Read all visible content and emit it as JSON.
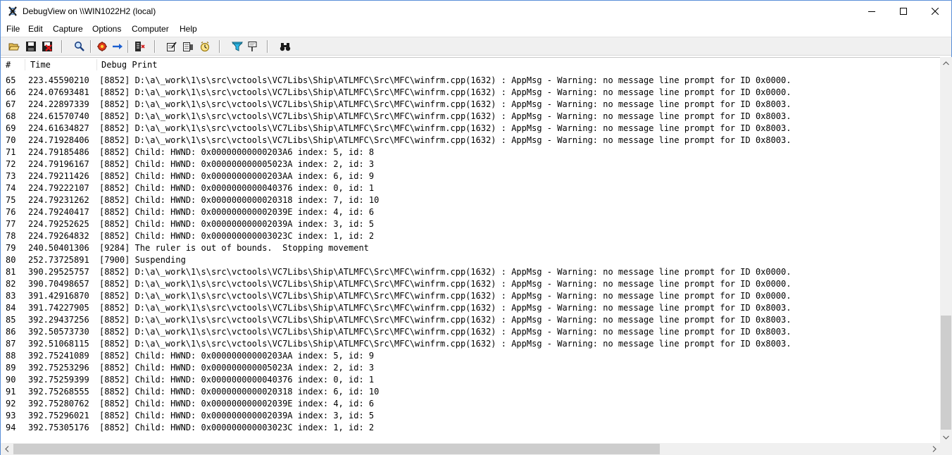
{
  "window": {
    "title": "DebugView on \\\\WIN1022H2 (local)"
  },
  "menu": [
    "File",
    "Edit",
    "Capture",
    "Options",
    "Computer",
    "Help"
  ],
  "toolbar": {
    "buttons": [
      "open-icon",
      "save-icon",
      "clear-display-icon",
      "find-icon",
      "capture-icon",
      "autoscroll-icon",
      "history-icon",
      "capture-win32-icon",
      "capture-kernel-icon",
      "clock-time-icon",
      "filter-icon",
      "highlight-icon",
      "binoculars-icon"
    ]
  },
  "columns": [
    "#",
    "Time",
    "Debug Print"
  ],
  "rows": [
    {
      "num": "65",
      "time": "223.45590210",
      "msg": "[8852] D:\\a\\_work\\1\\s\\src\\vctools\\VC7Libs\\Ship\\ATLMFC\\Src\\MFC\\winfrm.cpp(1632) : AppMsg - Warning: no message line prompt for ID 0x0000."
    },
    {
      "num": "66",
      "time": "224.07693481",
      "msg": "[8852] D:\\a\\_work\\1\\s\\src\\vctools\\VC7Libs\\Ship\\ATLMFC\\Src\\MFC\\winfrm.cpp(1632) : AppMsg - Warning: no message line prompt for ID 0x0000."
    },
    {
      "num": "67",
      "time": "224.22897339",
      "msg": "[8852] D:\\a\\_work\\1\\s\\src\\vctools\\VC7Libs\\Ship\\ATLMFC\\Src\\MFC\\winfrm.cpp(1632) : AppMsg - Warning: no message line prompt for ID 0x8003."
    },
    {
      "num": "68",
      "time": "224.61570740",
      "msg": "[8852] D:\\a\\_work\\1\\s\\src\\vctools\\VC7Libs\\Ship\\ATLMFC\\Src\\MFC\\winfrm.cpp(1632) : AppMsg - Warning: no message line prompt for ID 0x8003."
    },
    {
      "num": "69",
      "time": "224.61634827",
      "msg": "[8852] D:\\a\\_work\\1\\s\\src\\vctools\\VC7Libs\\Ship\\ATLMFC\\Src\\MFC\\winfrm.cpp(1632) : AppMsg - Warning: no message line prompt for ID 0x8003."
    },
    {
      "num": "70",
      "time": "224.71928406",
      "msg": "[8852] D:\\a\\_work\\1\\s\\src\\vctools\\VC7Libs\\Ship\\ATLMFC\\Src\\MFC\\winfrm.cpp(1632) : AppMsg - Warning: no message line prompt for ID 0x8003."
    },
    {
      "num": "71",
      "time": "224.79185486",
      "msg": "[8852] Child: HWND: 0x00000000000203A6 index: 5, id: 8"
    },
    {
      "num": "72",
      "time": "224.79196167",
      "msg": "[8852] Child: HWND: 0x000000000005023A index: 2, id: 3"
    },
    {
      "num": "73",
      "time": "224.79211426",
      "msg": "[8852] Child: HWND: 0x00000000000203AA index: 6, id: 9"
    },
    {
      "num": "74",
      "time": "224.79222107",
      "msg": "[8852] Child: HWND: 0x0000000000040376 index: 0, id: 1"
    },
    {
      "num": "75",
      "time": "224.79231262",
      "msg": "[8852] Child: HWND: 0x0000000000020318 index: 7, id: 10"
    },
    {
      "num": "76",
      "time": "224.79240417",
      "msg": "[8852] Child: HWND: 0x000000000002039E index: 4, id: 6"
    },
    {
      "num": "77",
      "time": "224.79252625",
      "msg": "[8852] Child: HWND: 0x000000000002039A index: 3, id: 5"
    },
    {
      "num": "78",
      "time": "224.79264832",
      "msg": "[8852] Child: HWND: 0x000000000003023C index: 1, id: 2"
    },
    {
      "num": "79",
      "time": "240.50401306",
      "msg": "[9284] The ruler is out of bounds.  Stopping movement"
    },
    {
      "num": "80",
      "time": "252.73725891",
      "msg": "[7900] Suspending"
    },
    {
      "num": "81",
      "time": "390.29525757",
      "msg": "[8852] D:\\a\\_work\\1\\s\\src\\vctools\\VC7Libs\\Ship\\ATLMFC\\Src\\MFC\\winfrm.cpp(1632) : AppMsg - Warning: no message line prompt for ID 0x0000."
    },
    {
      "num": "82",
      "time": "390.70498657",
      "msg": "[8852] D:\\a\\_work\\1\\s\\src\\vctools\\VC7Libs\\Ship\\ATLMFC\\Src\\MFC\\winfrm.cpp(1632) : AppMsg - Warning: no message line prompt for ID 0x0000."
    },
    {
      "num": "83",
      "time": "391.42916870",
      "msg": "[8852] D:\\a\\_work\\1\\s\\src\\vctools\\VC7Libs\\Ship\\ATLMFC\\Src\\MFC\\winfrm.cpp(1632) : AppMsg - Warning: no message line prompt for ID 0x0000."
    },
    {
      "num": "84",
      "time": "391.74227905",
      "msg": "[8852] D:\\a\\_work\\1\\s\\src\\vctools\\VC7Libs\\Ship\\ATLMFC\\Src\\MFC\\winfrm.cpp(1632) : AppMsg - Warning: no message line prompt for ID 0x8003."
    },
    {
      "num": "85",
      "time": "392.29437256",
      "msg": "[8852] D:\\a\\_work\\1\\s\\src\\vctools\\VC7Libs\\Ship\\ATLMFC\\Src\\MFC\\winfrm.cpp(1632) : AppMsg - Warning: no message line prompt for ID 0x8003."
    },
    {
      "num": "86",
      "time": "392.50573730",
      "msg": "[8852] D:\\a\\_work\\1\\s\\src\\vctools\\VC7Libs\\Ship\\ATLMFC\\Src\\MFC\\winfrm.cpp(1632) : AppMsg - Warning: no message line prompt for ID 0x8003."
    },
    {
      "num": "87",
      "time": "392.51068115",
      "msg": "[8852] D:\\a\\_work\\1\\s\\src\\vctools\\VC7Libs\\Ship\\ATLMFC\\Src\\MFC\\winfrm.cpp(1632) : AppMsg - Warning: no message line prompt for ID 0x8003."
    },
    {
      "num": "88",
      "time": "392.75241089",
      "msg": "[8852] Child: HWND: 0x00000000000203AA index: 5, id: 9"
    },
    {
      "num": "89",
      "time": "392.75253296",
      "msg": "[8852] Child: HWND: 0x000000000005023A index: 2, id: 3"
    },
    {
      "num": "90",
      "time": "392.75259399",
      "msg": "[8852] Child: HWND: 0x0000000000040376 index: 0, id: 1"
    },
    {
      "num": "91",
      "time": "392.75268555",
      "msg": "[8852] Child: HWND: 0x0000000000020318 index: 6, id: 10"
    },
    {
      "num": "92",
      "time": "392.75280762",
      "msg": "[8852] Child: HWND: 0x000000000002039E index: 4, id: 6"
    },
    {
      "num": "93",
      "time": "392.75296021",
      "msg": "[8852] Child: HWND: 0x000000000002039A index: 3, id: 5"
    },
    {
      "num": "94",
      "time": "392.75305176",
      "msg": "[8852] Child: HWND: 0x000000000003023C index: 1, id: 2"
    }
  ]
}
